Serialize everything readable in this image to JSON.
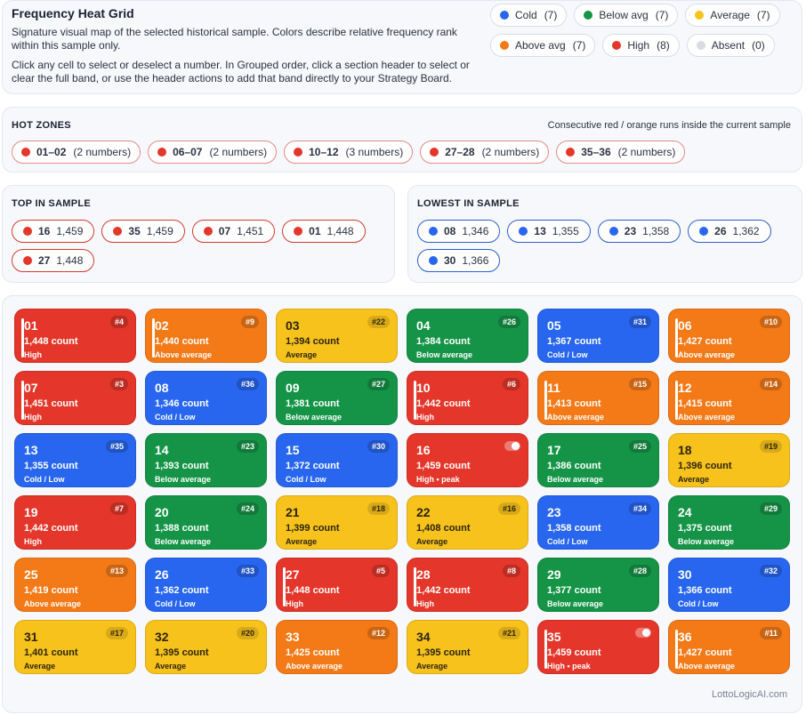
{
  "colors": {
    "cold": "#2866f0",
    "below_avg": "#159447",
    "average": "#f7c21c",
    "above_avg": "#f47a18",
    "high": "#e4362a",
    "absent": "#d8dbe2"
  },
  "header": {
    "title": "Frequency Heat Grid",
    "description_1": "Signature visual map of the selected historical sample. Colors describe relative frequency rank within this sample only.",
    "description_2": "Click any cell to select or deselect a number. In Grouped order, click a section header to select or clear the full band, or use the header actions to add that band directly to your Strategy Board."
  },
  "legend": [
    {
      "label": "Cold",
      "count": "(7)",
      "color": "#2866f0"
    },
    {
      "label": "Below avg",
      "count": "(7)",
      "color": "#159447"
    },
    {
      "label": "Average",
      "count": "(7)",
      "color": "#f7c21c"
    },
    {
      "label": "Above avg",
      "count": "(7)",
      "color": "#f47a18"
    },
    {
      "label": "High",
      "count": "(8)",
      "color": "#e4362a"
    },
    {
      "label": "Absent",
      "count": "(0)",
      "color": "#d8dbe2"
    }
  ],
  "hot_zones": {
    "title": "HOT ZONES",
    "note": "Consecutive red / orange runs inside the current sample",
    "zones": [
      {
        "range": "01–02",
        "count": "(2 numbers)"
      },
      {
        "range": "06–07",
        "count": "(2 numbers)"
      },
      {
        "range": "10–12",
        "count": "(3 numbers)"
      },
      {
        "range": "27–28",
        "count": "(2 numbers)"
      },
      {
        "range": "35–36",
        "count": "(2 numbers)"
      }
    ]
  },
  "top_in_sample": {
    "title": "TOP IN SAMPLE",
    "items": [
      {
        "num": "16",
        "value": "1,459"
      },
      {
        "num": "35",
        "value": "1,459"
      },
      {
        "num": "07",
        "value": "1,451"
      },
      {
        "num": "01",
        "value": "1,448"
      },
      {
        "num": "27",
        "value": "1,448"
      }
    ]
  },
  "lowest_in_sample": {
    "title": "LOWEST IN SAMPLE",
    "items": [
      {
        "num": "08",
        "value": "1,346"
      },
      {
        "num": "13",
        "value": "1,355"
      },
      {
        "num": "23",
        "value": "1,358"
      },
      {
        "num": "26",
        "value": "1,362"
      },
      {
        "num": "30",
        "value": "1,366"
      }
    ]
  },
  "grid": [
    {
      "num": "01",
      "count": "1,448 count",
      "label": "High",
      "rank": "#4",
      "band": "red",
      "peak": false,
      "selected": true
    },
    {
      "num": "02",
      "count": "1,440 count",
      "label": "Above average",
      "rank": "#9",
      "band": "orange",
      "peak": false,
      "selected": true
    },
    {
      "num": "03",
      "count": "1,394 count",
      "label": "Average",
      "rank": "#22",
      "band": "yellow",
      "peak": false,
      "selected": false
    },
    {
      "num": "04",
      "count": "1,384 count",
      "label": "Below average",
      "rank": "#26",
      "band": "green",
      "peak": false,
      "selected": false
    },
    {
      "num": "05",
      "count": "1,367 count",
      "label": "Cold / Low",
      "rank": "#31",
      "band": "blue",
      "peak": false,
      "selected": false
    },
    {
      "num": "06",
      "count": "1,427 count",
      "label": "Above average",
      "rank": "#10",
      "band": "orange",
      "peak": false,
      "selected": true
    },
    {
      "num": "07",
      "count": "1,451 count",
      "label": "High",
      "rank": "#3",
      "band": "red",
      "peak": false,
      "selected": true
    },
    {
      "num": "08",
      "count": "1,346 count",
      "label": "Cold / Low",
      "rank": "#36",
      "band": "blue",
      "peak": false,
      "selected": false
    },
    {
      "num": "09",
      "count": "1,381 count",
      "label": "Below average",
      "rank": "#27",
      "band": "green",
      "peak": false,
      "selected": false
    },
    {
      "num": "10",
      "count": "1,442 count",
      "label": "High",
      "rank": "#6",
      "band": "red",
      "peak": false,
      "selected": true
    },
    {
      "num": "11",
      "count": "1,413 count",
      "label": "Above average",
      "rank": "#15",
      "band": "orange",
      "peak": false,
      "selected": true
    },
    {
      "num": "12",
      "count": "1,415 count",
      "label": "Above average",
      "rank": "#14",
      "band": "orange",
      "peak": false,
      "selected": true
    },
    {
      "num": "13",
      "count": "1,355 count",
      "label": "Cold / Low",
      "rank": "#35",
      "band": "blue",
      "peak": false,
      "selected": false
    },
    {
      "num": "14",
      "count": "1,393 count",
      "label": "Below average",
      "rank": "#23",
      "band": "green",
      "peak": false,
      "selected": false
    },
    {
      "num": "15",
      "count": "1,372 count",
      "label": "Cold / Low",
      "rank": "#30",
      "band": "blue",
      "peak": false,
      "selected": false
    },
    {
      "num": "16",
      "count": "1,459 count",
      "label": "High • peak",
      "rank": "",
      "band": "red",
      "peak": true,
      "selected": false
    },
    {
      "num": "17",
      "count": "1,386 count",
      "label": "Below average",
      "rank": "#25",
      "band": "green",
      "peak": false,
      "selected": false
    },
    {
      "num": "18",
      "count": "1,396 count",
      "label": "Average",
      "rank": "#19",
      "band": "yellow",
      "peak": false,
      "selected": false
    },
    {
      "num": "19",
      "count": "1,442 count",
      "label": "High",
      "rank": "#7",
      "band": "red",
      "peak": false,
      "selected": false
    },
    {
      "num": "20",
      "count": "1,388 count",
      "label": "Below average",
      "rank": "#24",
      "band": "green",
      "peak": false,
      "selected": false
    },
    {
      "num": "21",
      "count": "1,399 count",
      "label": "Average",
      "rank": "#18",
      "band": "yellow",
      "peak": false,
      "selected": false
    },
    {
      "num": "22",
      "count": "1,408 count",
      "label": "Average",
      "rank": "#16",
      "band": "yellow",
      "peak": false,
      "selected": false
    },
    {
      "num": "23",
      "count": "1,358 count",
      "label": "Cold / Low",
      "rank": "#34",
      "band": "blue",
      "peak": false,
      "selected": false
    },
    {
      "num": "24",
      "count": "1,375 count",
      "label": "Below average",
      "rank": "#29",
      "band": "green",
      "peak": false,
      "selected": false
    },
    {
      "num": "25",
      "count": "1,419 count",
      "label": "Above average",
      "rank": "#13",
      "band": "orange",
      "peak": false,
      "selected": false
    },
    {
      "num": "26",
      "count": "1,362 count",
      "label": "Cold / Low",
      "rank": "#33",
      "band": "blue",
      "peak": false,
      "selected": false
    },
    {
      "num": "27",
      "count": "1,448 count",
      "label": "High",
      "rank": "#5",
      "band": "red",
      "peak": false,
      "selected": true
    },
    {
      "num": "28",
      "count": "1,442 count",
      "label": "High",
      "rank": "#8",
      "band": "red",
      "peak": false,
      "selected": true
    },
    {
      "num": "29",
      "count": "1,377 count",
      "label": "Below average",
      "rank": "#28",
      "band": "green",
      "peak": false,
      "selected": false
    },
    {
      "num": "30",
      "count": "1,366 count",
      "label": "Cold / Low",
      "rank": "#32",
      "band": "blue",
      "peak": false,
      "selected": false
    },
    {
      "num": "31",
      "count": "1,401 count",
      "label": "Average",
      "rank": "#17",
      "band": "yellow",
      "peak": false,
      "selected": false
    },
    {
      "num": "32",
      "count": "1,395 count",
      "label": "Average",
      "rank": "#20",
      "band": "yellow",
      "peak": false,
      "selected": false
    },
    {
      "num": "33",
      "count": "1,425 count",
      "label": "Above average",
      "rank": "#12",
      "band": "orange",
      "peak": false,
      "selected": false
    },
    {
      "num": "34",
      "count": "1,395 count",
      "label": "Average",
      "rank": "#21",
      "band": "yellow",
      "peak": false,
      "selected": false
    },
    {
      "num": "35",
      "count": "1,459 count",
      "label": "High • peak",
      "rank": "",
      "band": "red",
      "peak": true,
      "selected": true
    },
    {
      "num": "36",
      "count": "1,427 count",
      "label": "Above average",
      "rank": "#11",
      "band": "orange",
      "peak": false,
      "selected": true
    }
  ],
  "footer": "LottoLogicAI.com"
}
